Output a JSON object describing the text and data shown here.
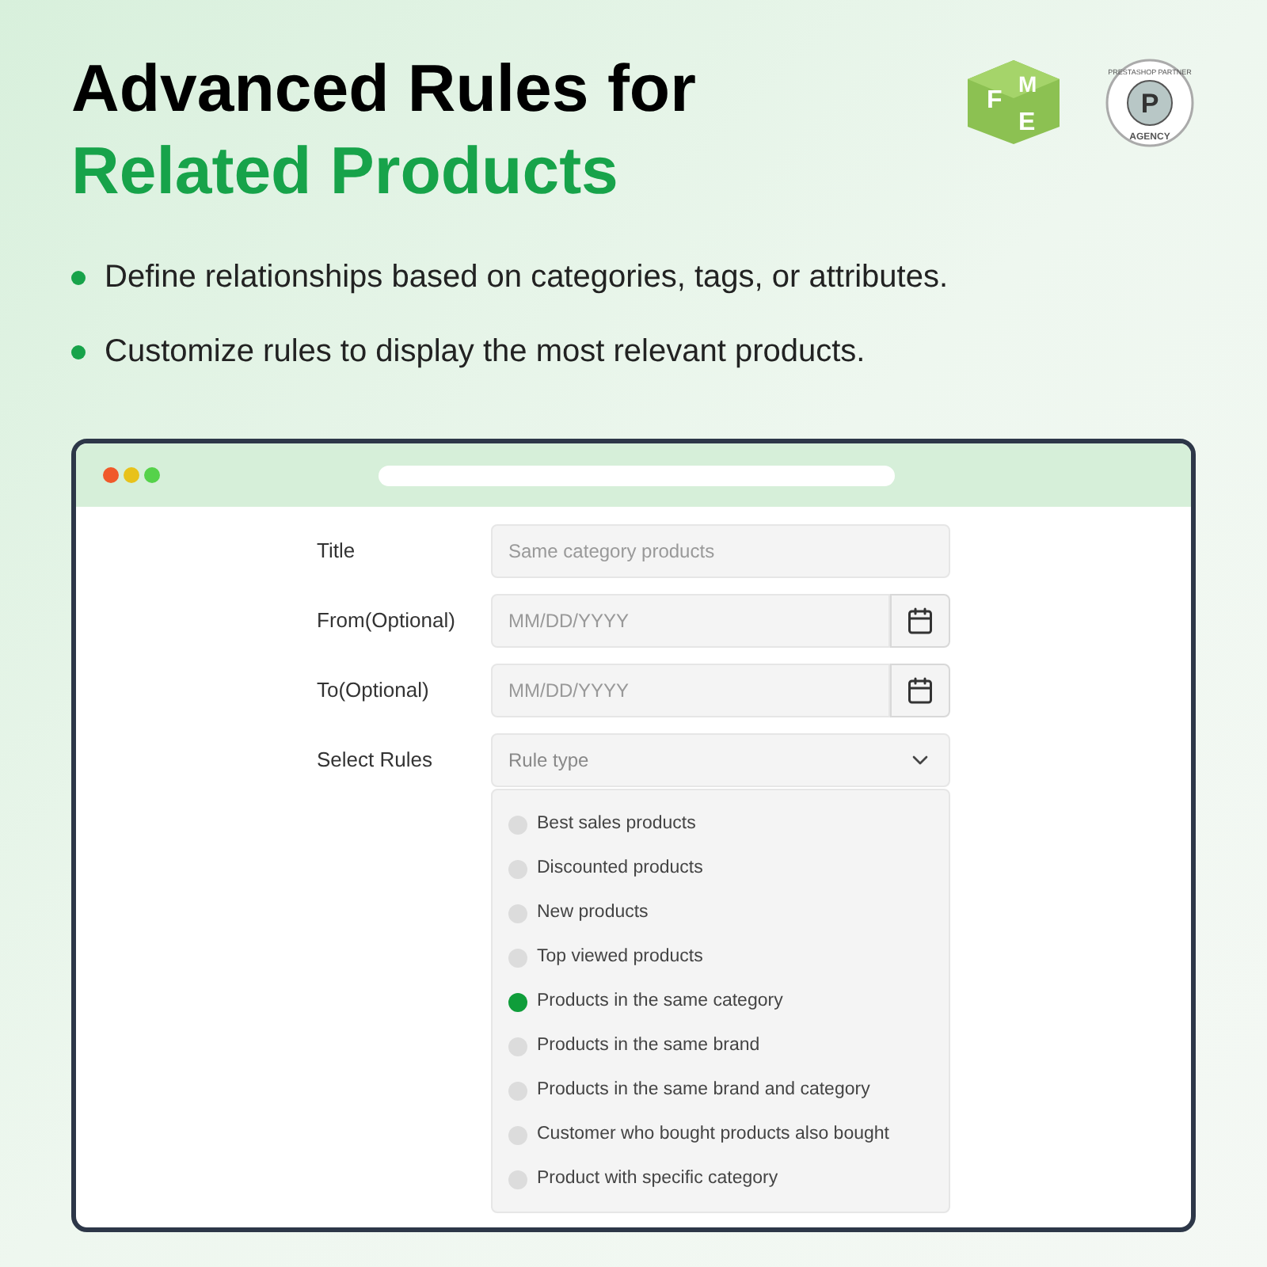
{
  "heading": {
    "line_1": "Advanced Rules for",
    "line_2": "Related Products"
  },
  "logos": {
    "fme": {
      "letters": [
        "F",
        "M",
        "E"
      ]
    },
    "partner": {
      "top_text": "PRESTASHOP PARTNER",
      "letter": "P",
      "bottom_text": "AGENCY"
    }
  },
  "bullets": [
    "Define relationships based on categories, tags, or attributes.",
    "Customize rules to display the most relevant products."
  ],
  "form": {
    "fields": [
      {
        "kind": "text",
        "label": "Title",
        "placeholder": "Same category products"
      },
      {
        "kind": "date",
        "label": "From(Optional)",
        "placeholder": "MM/DD/YYYY"
      },
      {
        "kind": "date",
        "label": "To(Optional)",
        "placeholder": "MM/DD/YYYY"
      },
      {
        "kind": "select",
        "label": "Select Rules",
        "placeholder": "Rule type"
      }
    ],
    "rule_options": [
      {
        "label": "Best sales products",
        "selected": false
      },
      {
        "label": "Discounted products",
        "selected": false
      },
      {
        "label": "New products",
        "selected": false
      },
      {
        "label": "Top viewed products",
        "selected": false
      },
      {
        "label": "Products in the same category",
        "selected": true
      },
      {
        "label": "Products in the same brand",
        "selected": false
      },
      {
        "label": "Products in the same brand and category",
        "selected": false
      },
      {
        "label": "Customer who bought products also bought",
        "selected": false
      },
      {
        "label": "Product with specific category",
        "selected": false
      }
    ]
  }
}
